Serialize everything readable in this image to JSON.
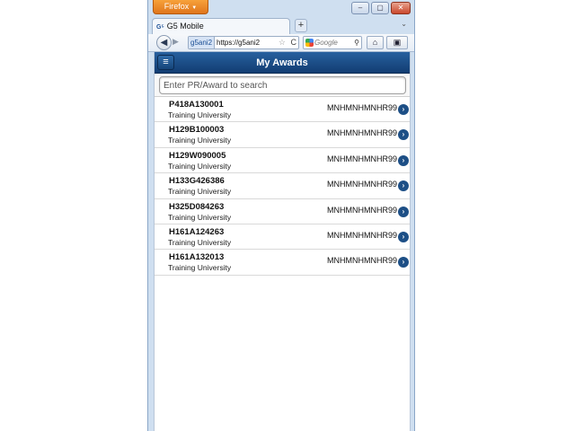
{
  "browser": {
    "menu_button_label": "Firefox",
    "window_controls": [
      "–",
      "▢",
      "✕"
    ],
    "tab_title": "G5 Mobile",
    "tab_favicon": "G⁵",
    "new_tab_label": "+",
    "identity_label": "g5ani2",
    "url": "https://g5ani2",
    "search_placeholder": "Google",
    "icons": {
      "back": "◀",
      "forward": "▶",
      "star": "☆",
      "reload": "C",
      "search": "⚲",
      "home": "⌂",
      "bookmarks": "▣"
    }
  },
  "app": {
    "menu_icon": "≡",
    "title": "My Awards",
    "search_placeholder": "Enter PR/Award to search",
    "chevron": "›",
    "accent_color": "#1d4f86"
  },
  "awards": [
    {
      "id": "P418A130001",
      "org": "Training University",
      "code": "MNHMNHMNHR99"
    },
    {
      "id": "H129B100003",
      "org": "Training University",
      "code": "MNHMNHMNHR99"
    },
    {
      "id": "H129W090005",
      "org": "Training University",
      "code": "MNHMNHMNHR99"
    },
    {
      "id": "H133G426386",
      "org": "Training University",
      "code": "MNHMNHMNHR99"
    },
    {
      "id": "H325D084263",
      "org": "Training University",
      "code": "MNHMNHMNHR99"
    },
    {
      "id": "H161A124263",
      "org": "Training University",
      "code": "MNHMNHMNHR99"
    },
    {
      "id": "H161A132013",
      "org": "Training University",
      "code": "MNHMNHMNHR99"
    }
  ]
}
